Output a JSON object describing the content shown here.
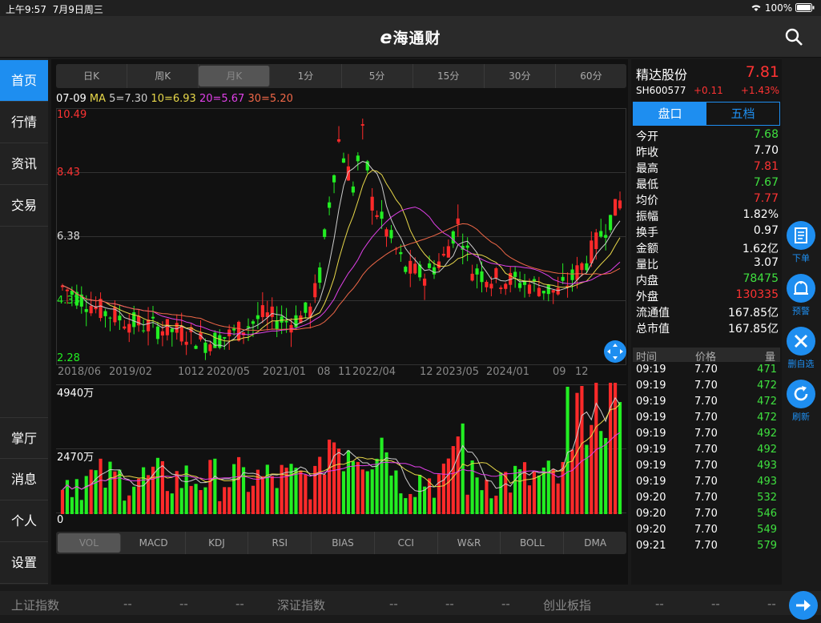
{
  "status": {
    "time": "上午9:57",
    "date": "7月9日周三",
    "battery": "100%"
  },
  "app": {
    "title": "海通财",
    "logo_letter": "e"
  },
  "sidebar": {
    "top": [
      "首页",
      "行情",
      "资讯",
      "交易"
    ],
    "bottom": [
      "掌厅",
      "消息",
      "个人",
      "设置"
    ]
  },
  "periods": [
    "日K",
    "周K",
    "月K",
    "1分",
    "5分",
    "15分",
    "30分",
    "60分"
  ],
  "ma": {
    "date": "07-09",
    "label": "MA",
    "ma5": "5=7.30",
    "ma10": "10=6.93",
    "ma20": "20=5.67",
    "ma30": "30=5.20"
  },
  "kaxis": {
    "top": "10.49",
    "l2": "8.43",
    "l3": "6.38",
    "l4": "4.33",
    "bottom": "2.28"
  },
  "xlabels": [
    "2018/06",
    "2019/02",
    "1012",
    "2020/05",
    "2021/01",
    "08",
    "11",
    "2022/04",
    "12",
    "2023/05",
    "2024/01",
    "09",
    "12"
  ],
  "vaxis": {
    "top": "4940万",
    "mid": "2470万",
    "zero": "0"
  },
  "indicators": [
    "VOL",
    "MACD",
    "KDJ",
    "RSI",
    "BIAS",
    "CCI",
    "W&R",
    "BOLL",
    "DMA"
  ],
  "stock": {
    "name": "精达股份",
    "price": "7.81",
    "code": "SH600577",
    "change": "+0.11",
    "pct": "+1.43%"
  },
  "tabs": [
    "盘口",
    "五档"
  ],
  "quote": [
    {
      "k": "今开",
      "v": "7.68",
      "c": "#3fe03f"
    },
    {
      "k": "昨收",
      "v": "7.70",
      "c": "#ffffff"
    },
    {
      "k": "最高",
      "v": "7.81",
      "c": "#ff3333"
    },
    {
      "k": "最低",
      "v": "7.67",
      "c": "#3fe03f"
    },
    {
      "k": "均价",
      "v": "7.77",
      "c": "#ff3333"
    },
    {
      "k": "振幅",
      "v": "1.82%",
      "c": "#ffffff"
    },
    {
      "k": "换手",
      "v": "0.97",
      "c": "#ffffff"
    },
    {
      "k": "金额",
      "v": "1.62亿",
      "c": "#ffffff"
    },
    {
      "k": "量比",
      "v": "3.07",
      "c": "#ffffff"
    },
    {
      "k": "内盘",
      "v": "78475",
      "c": "#3fe03f"
    },
    {
      "k": "外盘",
      "v": "130335",
      "c": "#ff3333"
    },
    {
      "k": "流通值",
      "v": "167.85亿",
      "c": "#ffffff"
    },
    {
      "k": "总市值",
      "v": "167.85亿",
      "c": "#ffffff"
    }
  ],
  "trade_header": {
    "time": "时间",
    "price": "价格",
    "vol": "量"
  },
  "trades": [
    [
      "09:19",
      "7.70",
      "471"
    ],
    [
      "09:19",
      "7.70",
      "472"
    ],
    [
      "09:19",
      "7.70",
      "472"
    ],
    [
      "09:19",
      "7.70",
      "472"
    ],
    [
      "09:19",
      "7.70",
      "492"
    ],
    [
      "09:19",
      "7.70",
      "492"
    ],
    [
      "09:19",
      "7.70",
      "493"
    ],
    [
      "09:19",
      "7.70",
      "493"
    ],
    [
      "09:20",
      "7.70",
      "532"
    ],
    [
      "09:20",
      "7.70",
      "546"
    ],
    [
      "09:20",
      "7.70",
      "549"
    ],
    [
      "09:21",
      "7.70",
      "579"
    ]
  ],
  "float": [
    "下单",
    "预警",
    "删自选",
    "刷新"
  ],
  "ticker": {
    "a": "上证指数",
    "b": "深证指数",
    "c": "创业板指",
    "dash": "--"
  },
  "colors": {
    "accent": "#1e8ef0",
    "up": "#ff2a2a",
    "down": "#22ee22"
  }
}
